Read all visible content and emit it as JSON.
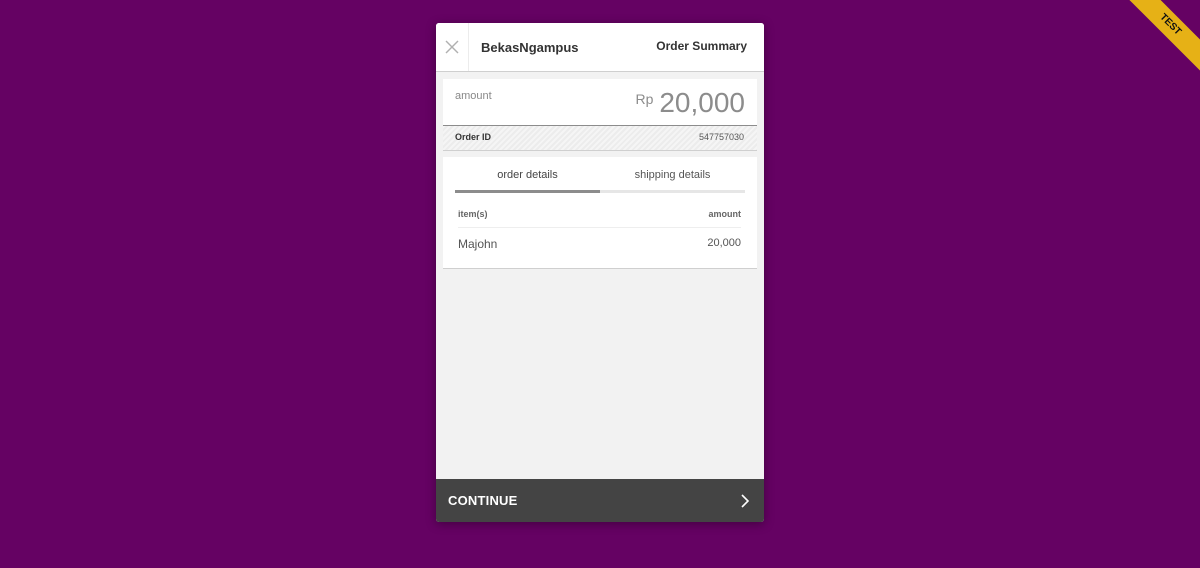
{
  "ribbon": {
    "label": "TEST",
    "color": "#e6b116"
  },
  "colors": {
    "background": "#650263",
    "button": "#444444",
    "panel": "#f2f2f2"
  },
  "header": {
    "close_icon": "close-icon",
    "merchant": "BekasNgampus",
    "title": "Order Summary"
  },
  "amount": {
    "label": "amount",
    "currency": "Rp",
    "value": "20,000"
  },
  "order": {
    "id_label": "Order ID",
    "id_value": "547757030"
  },
  "tabs": [
    {
      "label": "order details",
      "active": true
    },
    {
      "label": "shipping details",
      "active": false
    }
  ],
  "table": {
    "columns": [
      "item(s)",
      "amount"
    ],
    "rows": [
      {
        "item": "Majohn",
        "amount": "20,000"
      }
    ]
  },
  "footer": {
    "continue_label": "CONTINUE",
    "chevron_icon": "chevron-right-icon"
  }
}
